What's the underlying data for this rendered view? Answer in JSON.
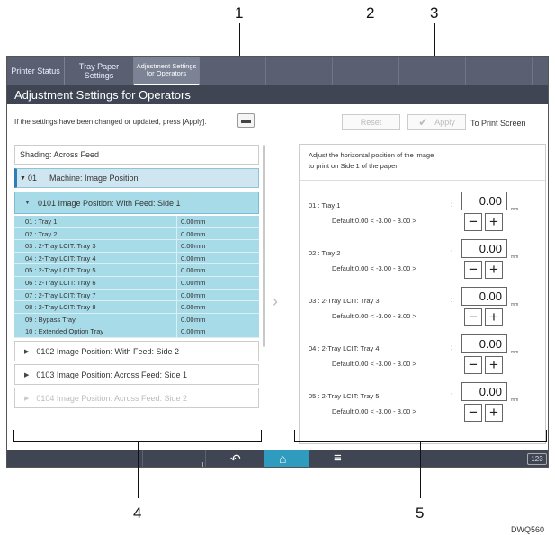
{
  "callouts": [
    "1",
    "2",
    "3",
    "4",
    "5"
  ],
  "tabs": {
    "printer_status": "Printer Status",
    "tray_paper_settings": "Tray Paper Settings",
    "adjustment_settings_line1": "Adjustment Settings",
    "adjustment_settings_line2": "for Operators"
  },
  "title": "Adjustment Settings for Operators",
  "info_text": "If the settings have been changed or updated, press [Apply].",
  "buttons": {
    "reset": "Reset",
    "apply": "Apply",
    "to_print_screen": "To Print Screen"
  },
  "left_list": {
    "shading": "Shading: Across Feed",
    "machine_code": "01",
    "machine_label": "Machine: Image Position",
    "item_0101": "0101 Image Position: With Feed: Side 1",
    "trays": [
      {
        "label": "01 : Tray 1",
        "value": "0.00",
        "unit": "mm"
      },
      {
        "label": "02 : Tray 2",
        "value": "0.00",
        "unit": "mm"
      },
      {
        "label": "03 : 2-Tray LCIT: Tray 3",
        "value": "0.00",
        "unit": "mm"
      },
      {
        "label": "04 : 2-Tray LCIT: Tray 4",
        "value": "0.00",
        "unit": "mm"
      },
      {
        "label": "05 : 2-Tray LCIT: Tray 5",
        "value": "0.00",
        "unit": "mm"
      },
      {
        "label": "06 : 2-Tray LCIT: Tray 6",
        "value": "0.00",
        "unit": "mm"
      },
      {
        "label": "07 : 2-Tray LCIT: Tray 7",
        "value": "0.00",
        "unit": "mm"
      },
      {
        "label": "08 : 2-Tray LCIT: Tray 8",
        "value": "0.00",
        "unit": "mm"
      },
      {
        "label": "09 : Bypass Tray",
        "value": "0.00",
        "unit": "mm"
      },
      {
        "label": "10 : Extended Option Tray",
        "value": "0.00",
        "unit": "mm"
      }
    ],
    "item_0102": "0102 Image Position: With Feed: Side 2",
    "item_0103": "0103 Image Position: Across Feed: Side 1",
    "item_0104": "0104 Image Position: Across Feed: Side 2"
  },
  "right_panel": {
    "description_line1": "Adjust the horizontal position of the image",
    "description_line2": "to print on Side 1 of the paper.",
    "entries": [
      {
        "label": "01 : Tray 1",
        "default": "Default:0.00 < -3.00 - 3.00 >",
        "value": "0.00",
        "unit": "mm"
      },
      {
        "label": "02 : Tray 2",
        "default": "Default:0.00 < -3.00 - 3.00 >",
        "value": "0.00",
        "unit": "mm"
      },
      {
        "label": "03 : 2-Tray LCIT: Tray 3",
        "default": "Default:0.00 < -3.00 - 3.00 >",
        "value": "0.00",
        "unit": "mm"
      },
      {
        "label": "04 : 2-Tray LCIT: Tray 4",
        "default": "Default:0.00 < -3.00 - 3.00 >",
        "value": "0.00",
        "unit": "mm"
      },
      {
        "label": "05 : 2-Tray LCIT: Tray 5",
        "default": "Default:0.00 < -3.00 - 3.00 >",
        "value": "0.00",
        "unit": "mm"
      }
    ],
    "colon": ":",
    "minus": "−",
    "plus": "+"
  },
  "bottom_bar": {
    "keyboard_label": "123"
  },
  "figure_code": "DWQ560",
  "icons": {
    "back": "back-arrow-icon",
    "home": "home-icon",
    "menu": "menu-icon",
    "apply_check": "checkmark-icon",
    "expand_down": "triangle-down-icon",
    "expand_right": "triangle-right-icon"
  },
  "colors": {
    "accent_teal": "#a8dbe8",
    "home_blue": "#2f9bbf",
    "dark_bar": "#404553"
  }
}
